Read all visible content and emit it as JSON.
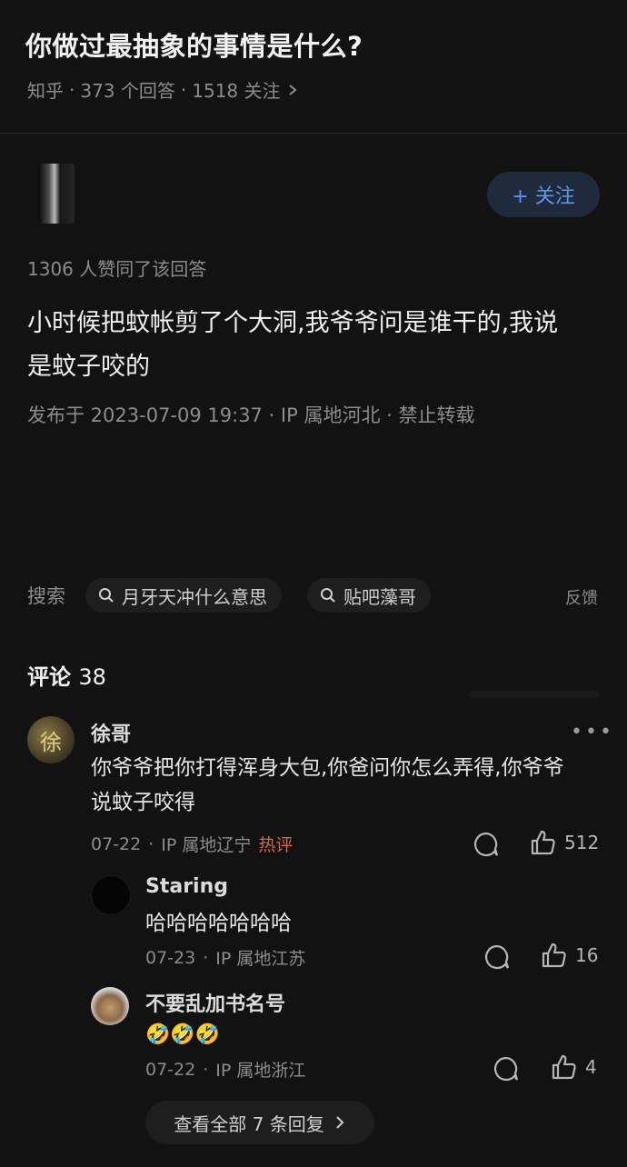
{
  "question": {
    "title": "你做过最抽象的事情是什么?",
    "source": "知乎",
    "answers": "373 个回答",
    "followers": "1518 关注",
    "sep": "·"
  },
  "answer": {
    "follow_label": "+ 关注",
    "likes_line": "1306 人赞同了该回答",
    "content": "小时候把蚊帐剪了个大洞,我爷爷问是谁干的,我说是蚊子咬的",
    "published": "发布于 2023-07-09 19:37 · IP 属地河北 · 禁止转载"
  },
  "search": {
    "label": "搜索",
    "chips": [
      "月牙天冲什么意思",
      "贴吧藻哥"
    ],
    "feedback": "反馈"
  },
  "comments": {
    "heading": "评论",
    "count": "38",
    "items": [
      {
        "avatar_text": "徐",
        "name": "徐哥",
        "text": "你爷爷把你打得浑身大包,你爸问你怎么弄得,你爷爷说蚊子咬得",
        "date": "07-22",
        "ip": "IP 属地辽宁",
        "tag": "热评",
        "likes": "512"
      },
      {
        "name": "Staring",
        "text": "哈哈哈哈哈哈哈",
        "date": "07-23",
        "ip": "IP 属地江苏",
        "likes": "16"
      },
      {
        "name": "不要乱加书名号",
        "text": "🤣🤣🤣",
        "date": "07-22",
        "ip": "IP 属地浙江",
        "likes": "4"
      }
    ],
    "view_all": "查看全部 7 条回复"
  },
  "colors": {
    "background": "#121212",
    "accent": "#5c93f0",
    "hot": "#e0652f"
  }
}
